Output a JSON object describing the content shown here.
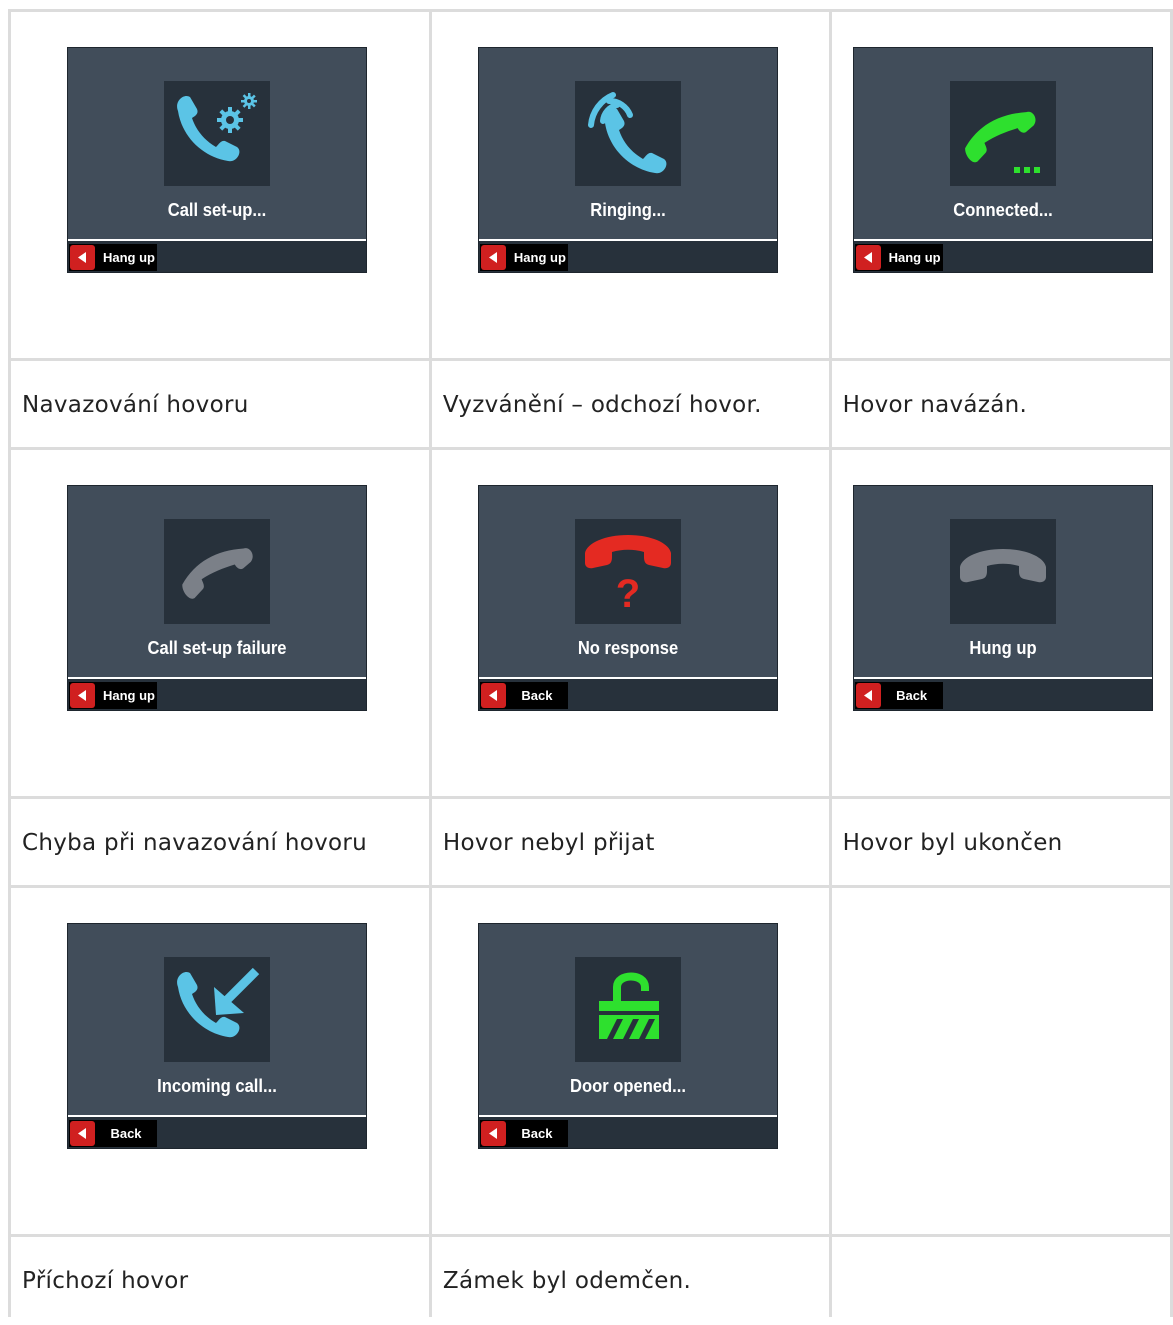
{
  "cells": [
    {
      "status": "Call set-up...",
      "softkey": "Hang up",
      "caption": "Navazování hovoru",
      "icon": "call-setup-gear-icon"
    },
    {
      "status": "Ringing...",
      "softkey": "Hang up",
      "caption": "Vyzvánění – odchozí hovor.",
      "icon": "phone-ringing-icon"
    },
    {
      "status": "Connected...",
      "softkey": "Hang up",
      "caption": "Hovor navázán.",
      "icon": "phone-connected-icon"
    },
    {
      "status": "Call set-up failure",
      "softkey": "Hang up",
      "caption": "Chyba při navazování hovoru",
      "icon": "phone-failure-icon"
    },
    {
      "status": "No response",
      "softkey": "Back",
      "caption": "Hovor nebyl přijat",
      "icon": "phone-no-response-icon"
    },
    {
      "status": "Hung up",
      "softkey": "Back",
      "caption": "Hovor byl ukončen",
      "icon": "phone-hung-up-icon"
    },
    {
      "status": "Incoming call...",
      "softkey": "Back",
      "caption": "Příchozí hovor",
      "icon": "incoming-call-icon"
    },
    {
      "status": "Door opened...",
      "softkey": "Back",
      "caption": "Zámek byl odemčen.",
      "icon": "unlocked-padlock-icon"
    }
  ],
  "colors": {
    "screen_bg": "#414d5a",
    "icon_bg": "#27313b",
    "blue": "#5bc4e6",
    "green": "#2ee02e",
    "gray": "#7b8088",
    "red": "#e42a22",
    "back_button": "#d02020"
  }
}
